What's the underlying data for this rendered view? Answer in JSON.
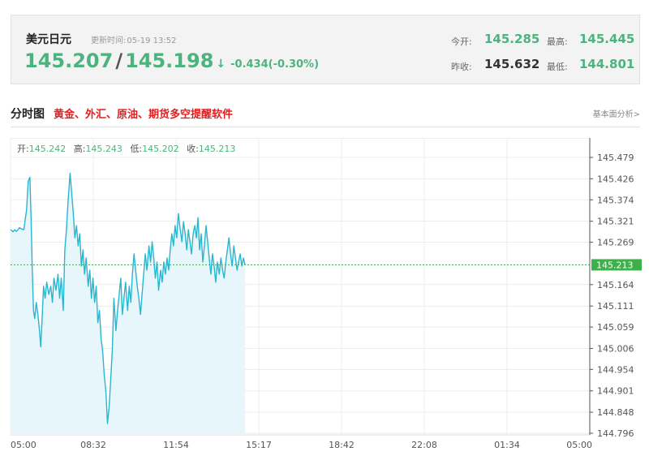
{
  "quote": {
    "name": "美元日元",
    "update_label": "更新时间:",
    "update_time": "05-19 13:52",
    "bid": "145.207",
    "slash": "/",
    "ask": "145.198",
    "arrow": "↓",
    "change": "-0.434(-0.30%)",
    "open_label": "今开:",
    "open": "145.285",
    "high_label": "最高:",
    "high": "145.445",
    "prev_close_label": "昨收:",
    "prev_close": "145.632",
    "low_label": "最低:",
    "low": "144.801"
  },
  "section": {
    "title": "分时图",
    "promo": "黄金、外汇、原油、期货多空提醒软件",
    "link": "基本面分析>"
  },
  "ohlc": {
    "open_label": "开:",
    "open": "145.242",
    "high_label": "高:",
    "high": "145.243",
    "low_label": "低:",
    "low": "145.202",
    "close_label": "收:",
    "close": "145.213"
  },
  "colors": {
    "line": "#29b6d0",
    "fill": "#e6f6fa",
    "green": "#4db37e",
    "ref": "#3cb14a",
    "promo": "#e02020"
  },
  "chart_data": {
    "type": "line",
    "x_ticks": [
      "05:00",
      "08:32",
      "11:54",
      "15:17",
      "18:42",
      "22:08",
      "01:34",
      "05:00"
    ],
    "y_ticks": [
      "145.479",
      "145.426",
      "145.374",
      "145.321",
      "145.269",
      "145.213",
      "145.164",
      "145.111",
      "145.059",
      "145.006",
      "144.954",
      "144.901",
      "144.848",
      "144.796"
    ],
    "ylim": [
      144.796,
      145.479
    ],
    "x_range_minutes": [
      0,
      1440
    ],
    "reference": {
      "value": 145.213,
      "label": "145.213"
    },
    "series": [
      {
        "x": [
          0,
          6,
          11,
          14,
          17,
          22,
          27,
          33,
          40,
          44,
          48,
          51,
          54,
          57,
          60,
          64,
          68,
          72,
          75,
          78,
          82,
          86,
          90,
          95,
          100,
          104,
          108,
          113,
          118,
          122,
          126,
          131,
          135,
          139,
          143,
          148,
          152,
          156,
          160,
          164,
          168,
          172,
          176,
          180,
          184,
          188,
          193,
          197,
          201,
          205,
          209,
          213,
          217,
          221,
          225,
          229,
          233,
          237,
          241,
          245,
          249,
          253,
          257,
          262,
          266,
          270,
          274,
          278,
          282,
          286,
          291,
          295,
          299,
          303,
          307,
          311,
          315,
          319,
          323,
          327,
          331,
          335,
          339,
          344,
          348,
          352,
          356,
          360,
          364,
          368,
          373,
          377,
          381,
          385,
          389,
          393,
          397,
          401,
          405,
          409,
          413,
          417,
          422,
          426,
          430,
          434,
          438,
          442,
          446,
          450,
          454,
          458,
          462,
          466,
          470,
          474,
          478,
          482,
          486,
          490,
          494,
          498,
          502,
          506,
          510,
          514,
          519,
          523,
          527,
          531,
          535,
          539,
          543,
          547,
          551,
          555,
          559,
          563,
          567,
          571,
          575,
          579,
          583
        ],
        "y": [
          145.3,
          145.295,
          145.3,
          145.296,
          145.298,
          145.305,
          145.302,
          145.3,
          145.35,
          145.42,
          145.43,
          145.33,
          145.2,
          145.1,
          145.08,
          145.12,
          145.09,
          145.05,
          145.01,
          145.07,
          145.16,
          145.13,
          145.17,
          145.14,
          145.16,
          145.12,
          145.18,
          145.15,
          145.19,
          145.13,
          145.18,
          145.1,
          145.25,
          145.3,
          145.37,
          145.44,
          145.39,
          145.34,
          145.28,
          145.31,
          145.26,
          145.29,
          145.21,
          145.25,
          145.19,
          145.23,
          145.16,
          145.2,
          145.13,
          145.18,
          145.12,
          145.16,
          145.07,
          145.1,
          145.03,
          145.0,
          144.94,
          144.9,
          144.82,
          144.86,
          144.93,
          145.0,
          145.13,
          145.05,
          145.1,
          145.14,
          145.18,
          145.09,
          145.13,
          145.17,
          145.1,
          145.16,
          145.12,
          145.19,
          145.24,
          145.2,
          145.16,
          145.13,
          145.09,
          145.14,
          145.19,
          145.24,
          145.2,
          145.26,
          145.22,
          145.27,
          145.23,
          145.18,
          145.22,
          145.15,
          145.2,
          145.17,
          145.22,
          145.19,
          145.23,
          145.2,
          145.25,
          145.29,
          145.26,
          145.31,
          145.28,
          145.34,
          145.3,
          145.27,
          145.32,
          145.29,
          145.25,
          145.3,
          145.27,
          145.24,
          145.29,
          145.31,
          145.28,
          145.33,
          145.25,
          145.29,
          145.22,
          145.26,
          145.31,
          145.27,
          145.23,
          145.19,
          145.24,
          145.21,
          145.17,
          145.22,
          145.19,
          145.23,
          145.2,
          145.18,
          145.22,
          145.25,
          145.28,
          145.24,
          145.21,
          145.26,
          145.23,
          145.2,
          145.22,
          145.24,
          145.21,
          145.23,
          145.213
        ]
      }
    ]
  }
}
